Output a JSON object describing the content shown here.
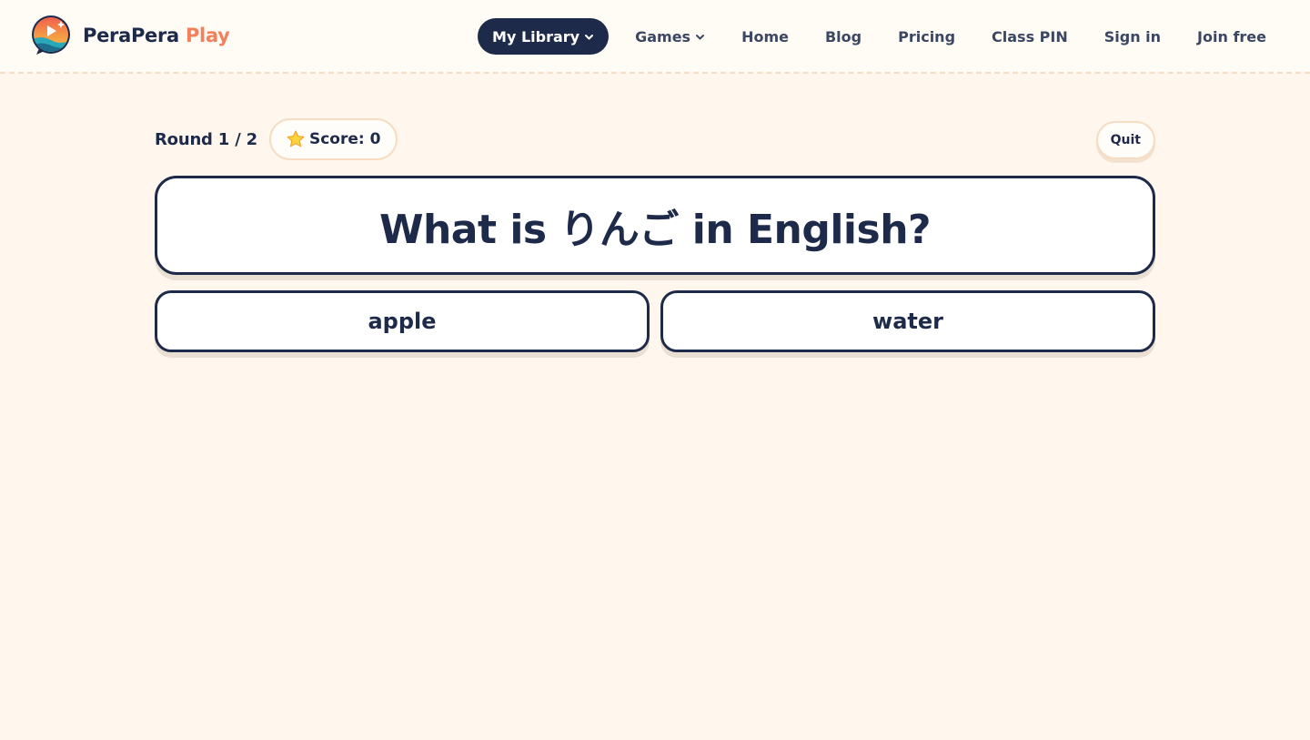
{
  "brand": {
    "name_main": "PeraPera",
    "name_accent": "Play",
    "logo_icon": "speech-bubble-logo-icon"
  },
  "nav": {
    "my_library": "My Library",
    "games": "Games",
    "home": "Home",
    "blog": "Blog",
    "pricing": "Pricing",
    "class_pin": "Class PIN",
    "sign_in": "Sign in",
    "join_free": "Join free"
  },
  "game": {
    "round_label": "Round 1 / 2",
    "score_label": "Score: 0",
    "quit_label": "Quit",
    "question": "What is りんご in English?",
    "answers": [
      "apple",
      "water"
    ]
  },
  "colors": {
    "background": "#fff7ed",
    "navy": "#1e2a4a",
    "accent": "#f47f5b",
    "border_soft": "#f6dcc0"
  }
}
